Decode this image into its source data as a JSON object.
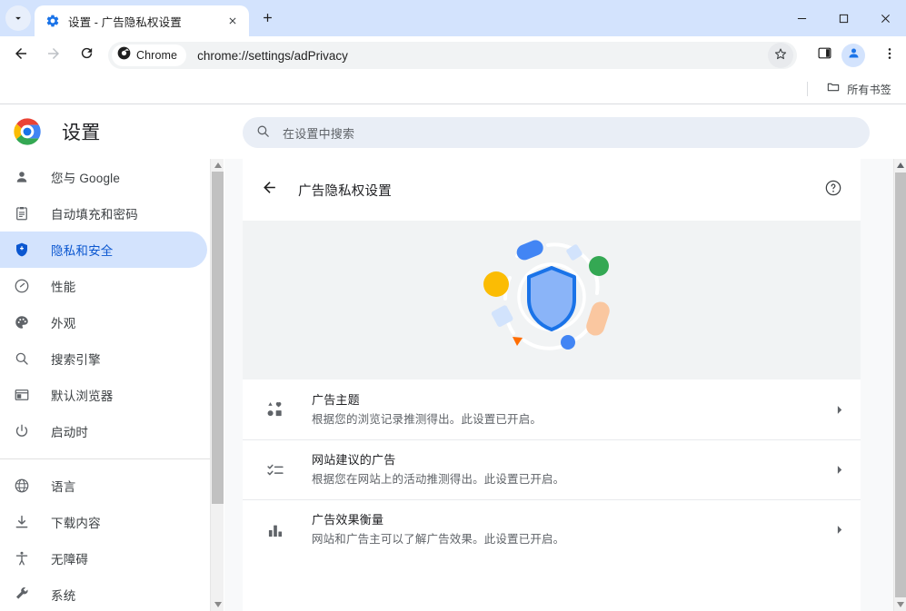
{
  "window": {
    "minimize_label": "—",
    "maximize_label": "□",
    "close_label": "✕"
  },
  "tabstrip": {
    "tab_search_icon": "chevron-down-icon",
    "tab": {
      "favicon": "settings-gear-icon",
      "title": "设置 - 广告隐私权设置",
      "close_icon": "close-icon"
    },
    "new_tab_icon": "plus-icon"
  },
  "toolbar": {
    "back_icon": "arrow-left-icon",
    "forward_icon": "arrow-right-icon",
    "reload_icon": "reload-icon",
    "chrome_chip_label": "Chrome",
    "url": "chrome://settings/adPrivacy",
    "bookmark_icon": "star-icon",
    "side_panel_icon": "side-panel-icon",
    "profile_icon": "account-avatar-icon",
    "menu_icon": "three-dot-menu-icon"
  },
  "bookmarks_bar": {
    "folder_icon": "folder-icon",
    "all_bookmarks_label": "所有书签"
  },
  "settings_header": {
    "logo": "chrome-logo-icon",
    "title": "设置",
    "search": {
      "icon": "search-icon",
      "placeholder": "在设置中搜索",
      "value": ""
    }
  },
  "sidebar": {
    "groups": [
      {
        "items": [
          {
            "icon": "person-icon",
            "label": "您与 Google",
            "selected": false
          },
          {
            "icon": "clipboard-icon",
            "label": "自动填充和密码",
            "selected": false
          },
          {
            "icon": "shield-icon",
            "label": "隐私和安全",
            "selected": true
          },
          {
            "icon": "speedometer-icon",
            "label": "性能",
            "selected": false
          },
          {
            "icon": "palette-icon",
            "label": "外观",
            "selected": false
          },
          {
            "icon": "search-icon",
            "label": "搜索引擎",
            "selected": false
          },
          {
            "icon": "browser-window-icon",
            "label": "默认浏览器",
            "selected": false
          },
          {
            "icon": "power-icon",
            "label": "启动时",
            "selected": false
          }
        ]
      },
      {
        "items": [
          {
            "icon": "globe-icon",
            "label": "语言",
            "selected": false
          },
          {
            "icon": "download-icon",
            "label": "下载内容",
            "selected": false
          },
          {
            "icon": "accessibility-icon",
            "label": "无障碍",
            "selected": false
          },
          {
            "icon": "wrench-icon",
            "label": "系统",
            "selected": false
          }
        ]
      }
    ],
    "scrollbar": {
      "up_icon": "triangle-up-icon",
      "down_icon": "triangle-down-icon"
    }
  },
  "main": {
    "back_icon": "arrow-left-icon",
    "page_title": "广告隐私权设置",
    "help_icon": "help-circle-icon",
    "hero": {
      "name": "ad-privacy-shield-illustration",
      "shield_fill": "#8AB4F8",
      "shield_stroke": "#1A73E8",
      "dots": [
        {
          "name": "blue-pill",
          "color": "#4285F4"
        },
        {
          "name": "light-blue-square-top",
          "color": "#D2E3FC"
        },
        {
          "name": "green-dot",
          "color": "#34A853"
        },
        {
          "name": "yellow-dot",
          "color": "#FBBC04"
        },
        {
          "name": "peach-pill",
          "color": "#FAC7A0"
        },
        {
          "name": "light-blue-square-left",
          "color": "#D2E3FC"
        },
        {
          "name": "orange-triangle",
          "color": "#FF6D00"
        },
        {
          "name": "small-blue-dot",
          "color": "#4285F4"
        }
      ]
    },
    "rows": [
      {
        "icon": "ad-topics-shapes-icon",
        "title": "广告主题",
        "subtitle": "根据您的浏览记录推测得出。此设置已开启。",
        "arrow": "chevron-right-icon"
      },
      {
        "icon": "checklist-icon",
        "title": "网站建议的广告",
        "subtitle": "根据您在网站上的活动推测得出。此设置已开启。",
        "arrow": "chevron-right-icon"
      },
      {
        "icon": "bar-chart-icon",
        "title": "广告效果衡量",
        "subtitle": "网站和广告主可以了解广告效果。此设置已开启。",
        "arrow": "chevron-right-icon"
      }
    ]
  },
  "colors": {
    "tabstrip_bg": "#D3E3FD",
    "selected_nav_bg": "#D3E3FD",
    "selected_nav_text": "#0B57D0",
    "omnibox_bg": "#F1F3F4",
    "search_bg": "#E9EEF6",
    "hero_bg": "#F1F3F4",
    "page_bg": "#F8F9FA"
  }
}
